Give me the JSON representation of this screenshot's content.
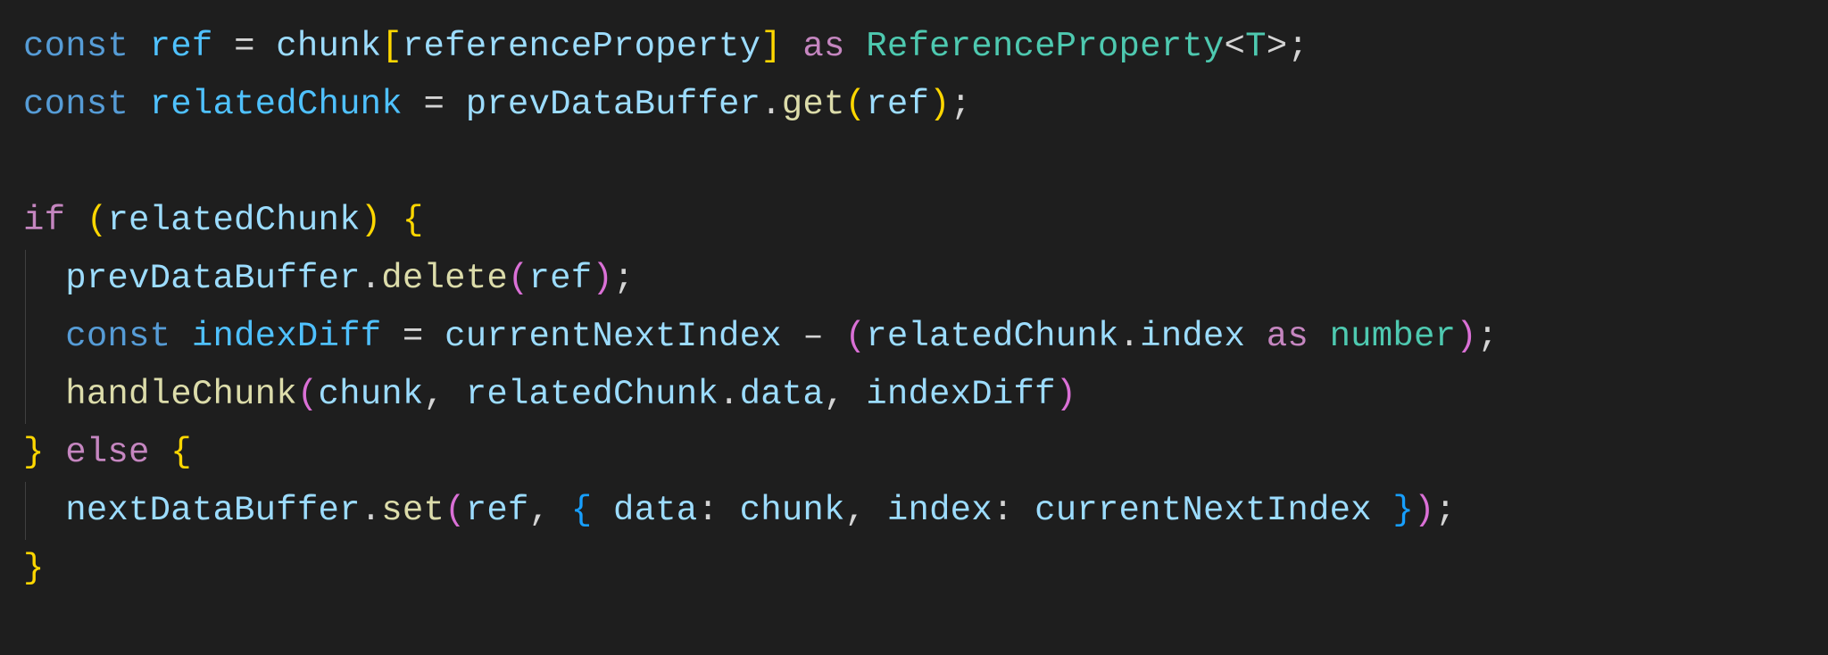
{
  "code": {
    "lines": [
      {
        "indent": 0,
        "tokens": [
          {
            "cls": "kw",
            "t": "const"
          },
          {
            "cls": "punc",
            "t": " "
          },
          {
            "cls": "var1",
            "t": "ref"
          },
          {
            "cls": "punc",
            "t": " "
          },
          {
            "cls": "punc",
            "t": "="
          },
          {
            "cls": "punc",
            "t": " "
          },
          {
            "cls": "var2",
            "t": "chunk"
          },
          {
            "cls": "brace-y",
            "t": "["
          },
          {
            "cls": "var2",
            "t": "referenceProperty"
          },
          {
            "cls": "brace-y",
            "t": "]"
          },
          {
            "cls": "punc",
            "t": " "
          },
          {
            "cls": "ctl",
            "t": "as"
          },
          {
            "cls": "punc",
            "t": " "
          },
          {
            "cls": "type",
            "t": "ReferenceProperty"
          },
          {
            "cls": "punc",
            "t": "<"
          },
          {
            "cls": "typar",
            "t": "T"
          },
          {
            "cls": "punc",
            "t": ">"
          },
          {
            "cls": "punc",
            "t": ";"
          }
        ]
      },
      {
        "indent": 0,
        "tokens": [
          {
            "cls": "kw",
            "t": "const"
          },
          {
            "cls": "punc",
            "t": " "
          },
          {
            "cls": "var1",
            "t": "relatedChunk"
          },
          {
            "cls": "punc",
            "t": " "
          },
          {
            "cls": "punc",
            "t": "="
          },
          {
            "cls": "punc",
            "t": " "
          },
          {
            "cls": "var2",
            "t": "prevDataBuffer"
          },
          {
            "cls": "punc",
            "t": "."
          },
          {
            "cls": "fn",
            "t": "get"
          },
          {
            "cls": "brace-y",
            "t": "("
          },
          {
            "cls": "var2",
            "t": "ref"
          },
          {
            "cls": "brace-y",
            "t": ")"
          },
          {
            "cls": "punc",
            "t": ";"
          }
        ]
      },
      {
        "indent": 0,
        "tokens": []
      },
      {
        "indent": 0,
        "tokens": [
          {
            "cls": "ctl",
            "t": "if"
          },
          {
            "cls": "punc",
            "t": " "
          },
          {
            "cls": "brace-y",
            "t": "("
          },
          {
            "cls": "var2",
            "t": "relatedChunk"
          },
          {
            "cls": "brace-y",
            "t": ")"
          },
          {
            "cls": "punc",
            "t": " "
          },
          {
            "cls": "brace-y",
            "t": "{"
          }
        ]
      },
      {
        "indent": 1,
        "tokens": [
          {
            "cls": "var2",
            "t": "prevDataBuffer"
          },
          {
            "cls": "punc",
            "t": "."
          },
          {
            "cls": "fn",
            "t": "delete"
          },
          {
            "cls": "brace-p",
            "t": "("
          },
          {
            "cls": "var2",
            "t": "ref"
          },
          {
            "cls": "brace-p",
            "t": ")"
          },
          {
            "cls": "punc",
            "t": ";"
          }
        ]
      },
      {
        "indent": 1,
        "tokens": [
          {
            "cls": "kw",
            "t": "const"
          },
          {
            "cls": "punc",
            "t": " "
          },
          {
            "cls": "var1",
            "t": "indexDiff"
          },
          {
            "cls": "punc",
            "t": " "
          },
          {
            "cls": "punc",
            "t": "="
          },
          {
            "cls": "punc",
            "t": " "
          },
          {
            "cls": "var2",
            "t": "currentNextIndex"
          },
          {
            "cls": "punc",
            "t": " "
          },
          {
            "cls": "punc",
            "t": "–"
          },
          {
            "cls": "punc",
            "t": " "
          },
          {
            "cls": "brace-p",
            "t": "("
          },
          {
            "cls": "var2",
            "t": "relatedChunk"
          },
          {
            "cls": "punc",
            "t": "."
          },
          {
            "cls": "var2",
            "t": "index"
          },
          {
            "cls": "punc",
            "t": " "
          },
          {
            "cls": "ctl",
            "t": "as"
          },
          {
            "cls": "punc",
            "t": " "
          },
          {
            "cls": "type",
            "t": "number"
          },
          {
            "cls": "brace-p",
            "t": ")"
          },
          {
            "cls": "punc",
            "t": ";"
          }
        ]
      },
      {
        "indent": 1,
        "tokens": [
          {
            "cls": "fn",
            "t": "handleChunk"
          },
          {
            "cls": "brace-p",
            "t": "("
          },
          {
            "cls": "var2",
            "t": "chunk"
          },
          {
            "cls": "punc",
            "t": ","
          },
          {
            "cls": "punc",
            "t": " "
          },
          {
            "cls": "var2",
            "t": "relatedChunk"
          },
          {
            "cls": "punc",
            "t": "."
          },
          {
            "cls": "var2",
            "t": "data"
          },
          {
            "cls": "punc",
            "t": ","
          },
          {
            "cls": "punc",
            "t": " "
          },
          {
            "cls": "var2",
            "t": "indexDiff"
          },
          {
            "cls": "brace-p",
            "t": ")"
          }
        ]
      },
      {
        "indent": 0,
        "tokens": [
          {
            "cls": "brace-y",
            "t": "}"
          },
          {
            "cls": "punc",
            "t": " "
          },
          {
            "cls": "ctl",
            "t": "else"
          },
          {
            "cls": "punc",
            "t": " "
          },
          {
            "cls": "brace-y",
            "t": "{"
          }
        ]
      },
      {
        "indent": 1,
        "tokens": [
          {
            "cls": "var2",
            "t": "nextDataBuffer"
          },
          {
            "cls": "punc",
            "t": "."
          },
          {
            "cls": "fn",
            "t": "set"
          },
          {
            "cls": "brace-p",
            "t": "("
          },
          {
            "cls": "var2",
            "t": "ref"
          },
          {
            "cls": "punc",
            "t": ","
          },
          {
            "cls": "punc",
            "t": " "
          },
          {
            "cls": "brace-b",
            "t": "{"
          },
          {
            "cls": "punc",
            "t": " "
          },
          {
            "cls": "var2",
            "t": "data"
          },
          {
            "cls": "punc",
            "t": ":"
          },
          {
            "cls": "punc",
            "t": " "
          },
          {
            "cls": "var2",
            "t": "chunk"
          },
          {
            "cls": "punc",
            "t": ","
          },
          {
            "cls": "punc",
            "t": " "
          },
          {
            "cls": "var2",
            "t": "index"
          },
          {
            "cls": "punc",
            "t": ":"
          },
          {
            "cls": "punc",
            "t": " "
          },
          {
            "cls": "var2",
            "t": "currentNextIndex"
          },
          {
            "cls": "punc",
            "t": " "
          },
          {
            "cls": "brace-b",
            "t": "}"
          },
          {
            "cls": "brace-p",
            "t": ")"
          },
          {
            "cls": "punc",
            "t": ";"
          }
        ]
      },
      {
        "indent": 0,
        "tokens": [
          {
            "cls": "brace-y",
            "t": "}"
          }
        ]
      }
    ]
  }
}
